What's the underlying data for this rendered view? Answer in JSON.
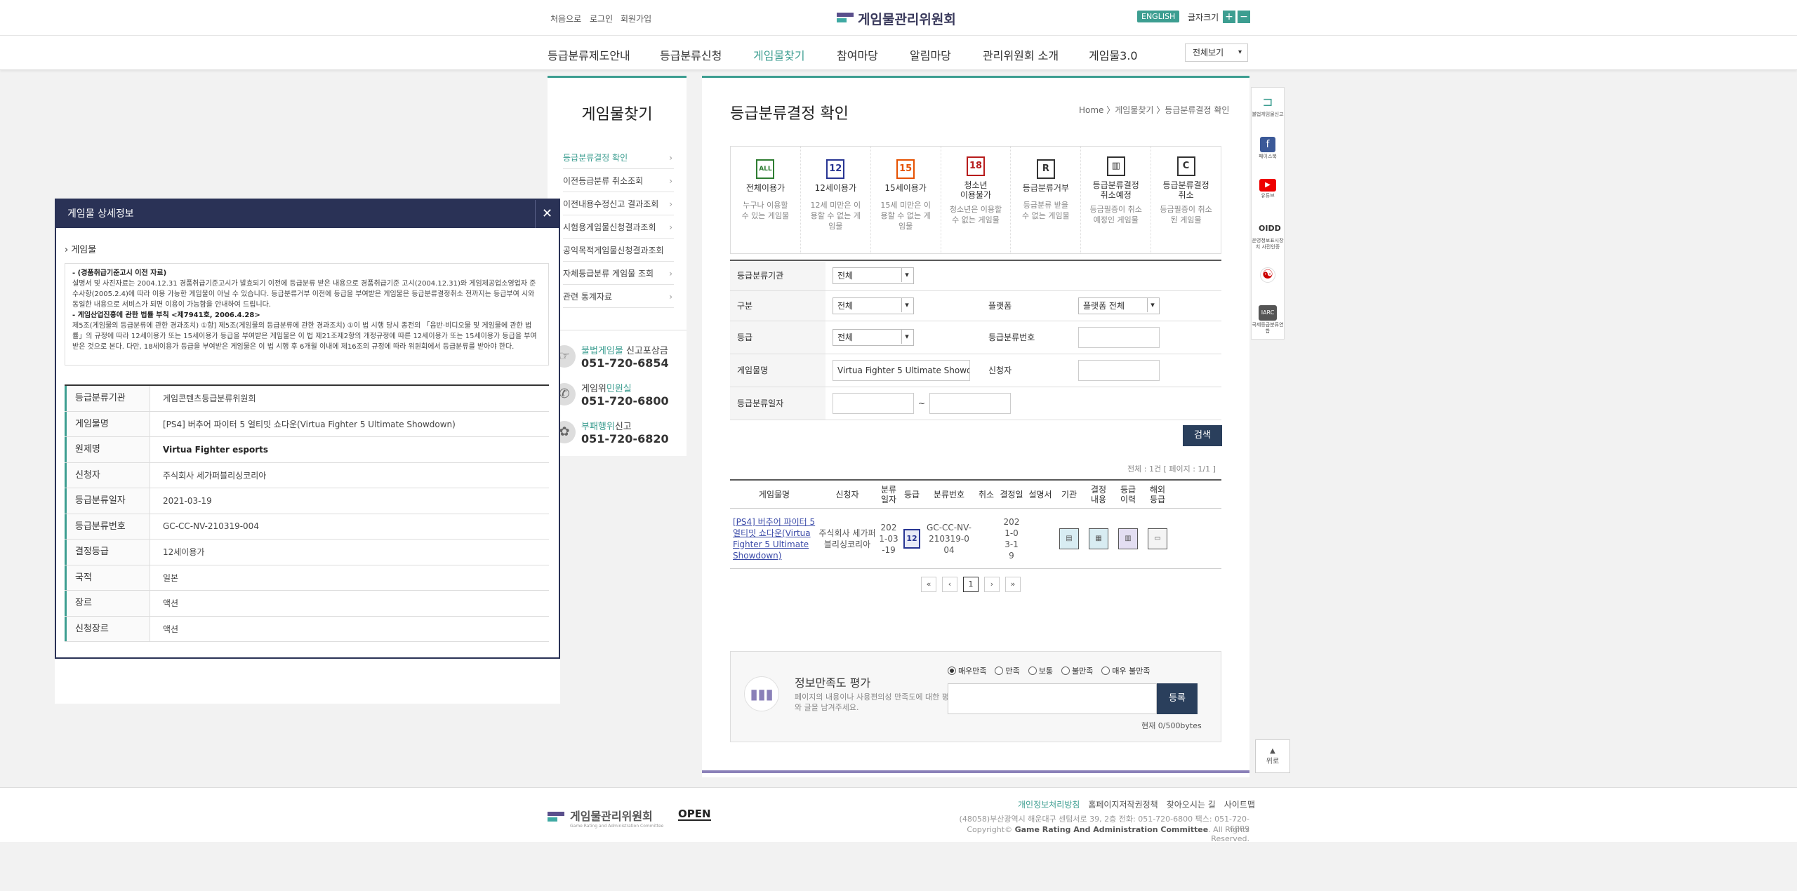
{
  "header": {
    "links": [
      "처음으로",
      "로그인",
      "회원가입"
    ],
    "logo": "게임물관리위원회",
    "english": "ENGLISH",
    "font_size_label": "글자크기",
    "plus": "+",
    "minus": "−"
  },
  "nav": {
    "items": [
      "등급분류제도안내",
      "등급분류신청",
      "게임물찾기",
      "참여마당",
      "알림마당",
      "관리위원회 소개",
      "게임물3.0"
    ],
    "active_index": 2,
    "all_view": "전체보기"
  },
  "subnav": {
    "title": "게임물찾기",
    "items": [
      "등급분류결정 확인",
      "이전등급분류 취소조회",
      "이전내용수정신고 결과조회",
      "시험용게임물신청결과조회",
      "공익목적게임물신청결과조회",
      "자체등급분류 게임물 조회",
      "관련 통계자료"
    ]
  },
  "contact": [
    {
      "pre": "불법게임물",
      "post": " 신고포상금",
      "tel": "051-720-6854"
    },
    {
      "pre": "게임위",
      "mid": "민원실",
      "post": "",
      "tel": "051-720-6800"
    },
    {
      "pre": "부패행위",
      "post": "신고",
      "tel": "051-720-6820"
    }
  ],
  "main": {
    "title": "등급분류결정 확인",
    "breadcrumb": "Home 〉게임물찾기 〉등급분류결정 확인"
  },
  "ratings": [
    {
      "icon": "ALL",
      "name": "전체이용가",
      "desc": "누구나 이용할 수 있는 게임물",
      "color": "#2e7d32"
    },
    {
      "icon": "12",
      "name": "12세이용가",
      "desc": "12세 미만은 이용할 수 없는 게임물",
      "color": "#283593"
    },
    {
      "icon": "15",
      "name": "15세이용가",
      "desc": "15세 미만은 이용할 수 없는 게임물",
      "color": "#e65100"
    },
    {
      "icon": "18",
      "name": "청소년\n이용불가",
      "desc": "청소년은 이용할 수 없는 게임물",
      "color": "#b71c1c"
    },
    {
      "icon": "R",
      "name": "등급분류거부",
      "desc": "등급분류 받을 수 없는 게임물",
      "color": "#222222"
    },
    {
      "icon": "▥",
      "name": "등급분류결정\n취소예정",
      "desc": "등급필증이 취소예정인 게임물",
      "color": "#222222"
    },
    {
      "icon": "C",
      "name": "등급분류결정\n취소",
      "desc": "등급필증이 취소된 게임물",
      "color": "#222222"
    }
  ],
  "filter": {
    "agency_label": "등급분류기관",
    "agency_value": "전체",
    "category_label": "구분",
    "category_value": "전체",
    "platform_label": "플랫폼",
    "platform_value": "플랫폼 전체",
    "grade_label": "등급",
    "grade_value": "전체",
    "number_label": "등급분류번호",
    "number_value": "",
    "game_label": "게임물명",
    "game_value": "Virtua Fighter 5 Ultimate Showdown",
    "applicant_label": "신청자",
    "applicant_value": "",
    "date_label": "등급분류일자",
    "date_sep": "~",
    "search": "검색"
  },
  "total": "전체 : 1건 [ 페이지 : 1/1 ]",
  "results": {
    "headers": [
      "게임물명",
      "신청자",
      "분류\n일자",
      "등급",
      "분류번호",
      "취소",
      "결정일",
      "설명서",
      "기관",
      "결정\n내용",
      "등급\n이력",
      "해외\n등급"
    ],
    "row": {
      "name": "[PS4] 버추어 파이터 5 얼티밋 쇼다운(Virtua Fighter 5 Ultimate Showdown)",
      "applicant": "주식회사 세가퍼블리싱코리아",
      "date": "2021-03-19",
      "grade_icon": "12",
      "number": "GC-CC-NV-210319-004",
      "decision_date": "2021-03-19"
    }
  },
  "pager": {
    "first": "«",
    "prev": "‹",
    "page": "1",
    "next": "›",
    "last": "»"
  },
  "satisfaction": {
    "title": "정보만족도 평가",
    "desc": "페이지의 내용이나 사용편의성 만족도에 대한 평가와 글을 남겨주세요.",
    "options": [
      "매우만족",
      "만족",
      "보통",
      "불만족",
      "매우 불만족"
    ],
    "selected": 0,
    "submit": "등록",
    "count": "현재 0/500bytes"
  },
  "quick": [
    "불법게임물신고",
    "페이스북",
    "유튜브",
    "운영정보표시장치 사전인증",
    "",
    "국제등급분류연합"
  ],
  "quick_top": "위로",
  "footer": {
    "logo": "게임물관리위원회",
    "logo_sub": "Game Rating and Administration Committee",
    "open": "OPEN",
    "links": [
      "개인정보처리방침",
      "홈페이지저작권정책",
      "찾아오시는 길",
      "사이트맵"
    ],
    "address": "(48058)부산광역시 해운대구 센텀서로 39, 2층 전화: 051-720-6800 팩스: 051-720-6889",
    "copy_pre": "Copyright© ",
    "copy_org": "Game Rating And Administration Committee",
    "copy_post": ". All Rights Reserved."
  },
  "popup": {
    "title": "게임물 상세정보",
    "close": "✕",
    "section": "› 게임물",
    "note": [
      {
        "t": "- (경품취급기준고시 이전 자료)",
        "bold": true
      },
      {
        "t": "설명서 및 사진자료는 2004.12.31 경품취급기준고시가 발효되기 이전에 등급분류 받은 내용으로 경품취급기준 고시(2004.12.31)와 게임제공업소영업자 준수사항(2005.2.4)에 따라 이용 가능한 게임물이 아닐 수 있습니다. 등급분류거부 이전에 등급을 부여받은 게임물은 등급분류결정취소 전까지는 등급부여 시와 동일한 내용으로 서비스가 되면 이용이 가능함을 안내하여 드립니다.",
        "bold": false
      },
      {
        "t": "- 게임산업진흥에 관한 법률 부칙 <제7941호, 2006.4.28>",
        "bold": true
      },
      {
        "t": "제5조(게임물의 등급분류에 관한 경과조치) ①항] 제5조(게임물의 등급분류에 관한 경과조치) ①이 법 시행 당시 종전의 「음반·비디오물 및 게임물에 관한 법률」의 규정에 따라 12세이용가 또는 15세이용가 등급을 부여받은 게임물은 이 법 제21조제2항의 개정규정에 따른 12세이용가 또는 15세이용가 등급을 부여받은 것으로 본다. 다만, 18세이용가 등급을 부여받은 게임물은 이 법 시행 후 6개월 이내에 제16조의 규정에 따라 위원회에서 등급분류를 받아야 한다.",
        "bold": false
      }
    ],
    "rows": [
      {
        "label": "등급분류기관",
        "value": "게임콘텐츠등급분류위원회",
        "bold": false
      },
      {
        "label": "게임물명",
        "value": "[PS4] 버추어 파이터 5 얼티밋 쇼다운(Virtua Fighter 5 Ultimate Showdown)",
        "bold": false
      },
      {
        "label": "원제명",
        "value": "Virtua Fighter esports",
        "bold": true
      },
      {
        "label": "신청자",
        "value": "주식회사 세가퍼블리싱코리아",
        "bold": false
      },
      {
        "label": "등급분류일자",
        "value": "2021-03-19",
        "bold": false
      },
      {
        "label": "등급분류번호",
        "value": "GC-CC-NV-210319-004",
        "bold": false
      },
      {
        "label": "결정등급",
        "value": "12세이용가",
        "bold": false
      },
      {
        "label": "국적",
        "value": "일본",
        "bold": false
      },
      {
        "label": "장르",
        "value": "액션",
        "bold": false
      },
      {
        "label": "신청장르",
        "value": "액션",
        "bold": false
      }
    ]
  }
}
